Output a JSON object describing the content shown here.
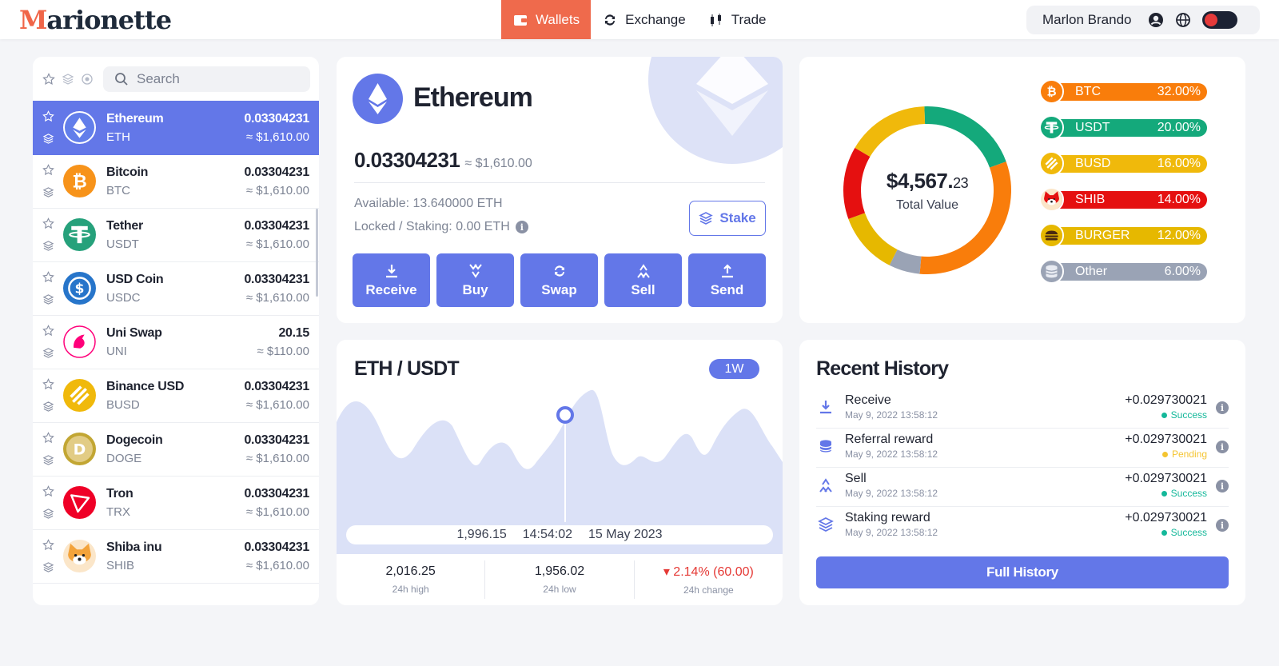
{
  "app": {
    "logo_rest": "arionette"
  },
  "nav": {
    "items": [
      {
        "label": "Wallets",
        "icon": "wallet-icon",
        "active": true
      },
      {
        "label": "Exchange",
        "icon": "refresh-icon",
        "active": false
      },
      {
        "label": "Trade",
        "icon": "candlestick-icon",
        "active": false
      }
    ]
  },
  "user": {
    "name": "Marlon Brando"
  },
  "search": {
    "placeholder": "Search"
  },
  "coins": [
    {
      "name": "Ethereum",
      "symbol": "ETH",
      "amount": "0.03304231",
      "usd": "≈ $1,610.00",
      "color": "#627eea",
      "icon": "ethereum-icon",
      "active": true
    },
    {
      "name": "Bitcoin",
      "symbol": "BTC",
      "amount": "0.03304231",
      "usd": "≈ $1,610.00",
      "color": "#f7931a",
      "icon": "bitcoin-icon"
    },
    {
      "name": "Tether",
      "symbol": "USDT",
      "amount": "0.03304231",
      "usd": "≈ $1,610.00",
      "color": "#26a17b",
      "icon": "tether-icon"
    },
    {
      "name": "USD Coin",
      "symbol": "USDC",
      "amount": "0.03304231",
      "usd": "≈ $1,610.00",
      "color": "#2775ca",
      "icon": "usdc-icon"
    },
    {
      "name": "Uni Swap",
      "symbol": "UNI",
      "amount": "20.15",
      "usd": "≈ $110.00",
      "color": "#ff007a",
      "icon": "unicorn-icon"
    },
    {
      "name": "Binance USD",
      "symbol": "BUSD",
      "amount": "0.03304231",
      "usd": "≈ $1,610.00",
      "color": "#f0b90b",
      "icon": "busd-icon"
    },
    {
      "name": "Dogecoin",
      "symbol": "DOGE",
      "amount": "0.03304231",
      "usd": "≈ $1,610.00",
      "color": "#c2a633",
      "icon": "dogecoin-icon"
    },
    {
      "name": "Tron",
      "symbol": "TRX",
      "amount": "0.03304231",
      "usd": "≈ $1,610.00",
      "color": "#ef0027",
      "icon": "tron-icon"
    },
    {
      "name": "Shiba inu",
      "symbol": "SHIB",
      "amount": "0.03304231",
      "usd": "≈ $1,610.00",
      "color": "#f3a33b",
      "icon": "shiba-icon"
    }
  ],
  "wallet": {
    "name": "Ethereum",
    "balance": "0.03304231",
    "balance_usd": "≈ $1,610.00",
    "available": "Available:  13.640000 ETH",
    "locked": "Locked / Staking:  0.00 ETH",
    "stake_label": "Stake",
    "actions": [
      {
        "label": "Receive",
        "icon": "download-icon"
      },
      {
        "label": "Buy",
        "icon": "buy-icon"
      },
      {
        "label": "Swap",
        "icon": "swap-icon"
      },
      {
        "label": "Sell",
        "icon": "sell-icon"
      },
      {
        "label": "Send",
        "icon": "upload-icon"
      }
    ]
  },
  "distribution": {
    "total_main": "$4,567.",
    "total_cents": "23",
    "total_label": "Total Value",
    "items": [
      {
        "name": "BTC",
        "pct": "32.00%",
        "value": 32,
        "color": "#f97d0b",
        "icon": "bitcoin-icon"
      },
      {
        "name": "USDT",
        "pct": "20.00%",
        "value": 20,
        "color": "#14a97b",
        "icon": "tether-icon"
      },
      {
        "name": "BUSD",
        "pct": "16.00%",
        "value": 16,
        "color": "#f0b90b",
        "icon": "busd-icon"
      },
      {
        "name": "SHIB",
        "pct": "14.00%",
        "value": 14,
        "color": "#e51010",
        "icon": "shiba-icon"
      },
      {
        "name": "BURGER",
        "pct": "12.00%",
        "value": 12,
        "color": "#e6b800",
        "icon": "burger-icon"
      },
      {
        "name": "Other",
        "pct": "6.00%",
        "value": 6,
        "color": "#9aa3b5",
        "icon": "stack-icon"
      }
    ]
  },
  "chart": {
    "title": "ETH / USDT",
    "period": "1W",
    "tooltip_value": "1,996.15",
    "tooltip_time": "14:54:02",
    "tooltip_date": "15 May 2023",
    "stats": [
      {
        "value": "2,016.25",
        "label": "24h high"
      },
      {
        "value": "1,956.02",
        "label": "24h low"
      },
      {
        "value": "▾ 2.14% (60.00)",
        "label": "24h change",
        "negative": true
      }
    ],
    "colors": {
      "fill": "#dbe1f7",
      "marker": "#6377e8"
    }
  },
  "history": {
    "title": "Recent History",
    "items": [
      {
        "name": "Receive",
        "date": "May 9, 2022  13:58:12",
        "amount": "+0.029730021",
        "status": "Success",
        "status_color": "#14b89a",
        "icon": "download-icon"
      },
      {
        "name": "Referral reward",
        "date": "May 9, 2022  13:58:12",
        "amount": "+0.029730021",
        "status": "Pending",
        "status_color": "#f4c430",
        "icon": "coins-icon"
      },
      {
        "name": "Sell",
        "date": "May 9, 2022  13:58:12",
        "amount": "+0.029730021",
        "status": "Success",
        "status_color": "#14b89a",
        "icon": "sell-icon"
      },
      {
        "name": "Staking reward",
        "date": "May 9, 2022  13:58:12",
        "amount": "+0.029730021",
        "status": "Success",
        "status_color": "#14b89a",
        "icon": "stack-icon"
      }
    ],
    "button_label": "Full History"
  }
}
